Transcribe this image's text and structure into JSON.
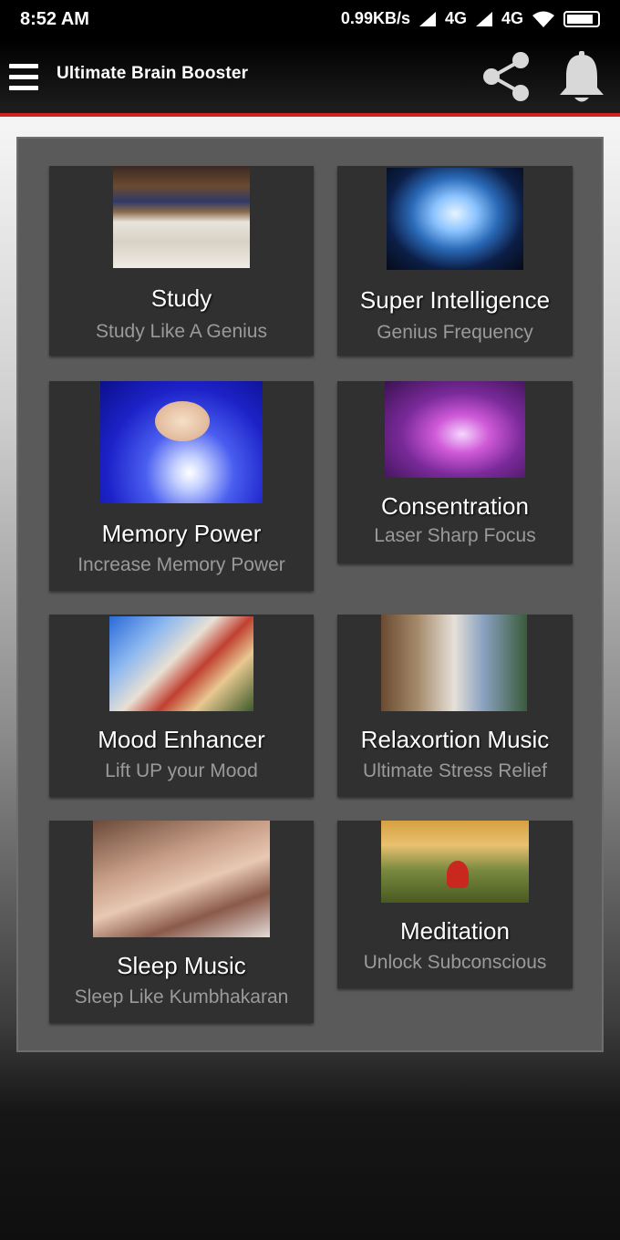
{
  "status_bar": {
    "time": "8:52 AM",
    "network": "0.99KB/s",
    "signal_a": "4G",
    "signal_b": "4G"
  },
  "app_bar": {
    "title": "Ultimate Brain Booster",
    "accent_color": "#d32222",
    "icons": [
      "menu-icon",
      "share-icon",
      "bell-icon"
    ]
  },
  "cards": [
    {
      "title": "Study",
      "subtitle": "Study Like A Genius",
      "image": "books-image"
    },
    {
      "title": "Super Intelligence",
      "subtitle": "Genius Frequency",
      "image": "glowing-brain-image"
    },
    {
      "title": "Memory Power",
      "subtitle": "Increase Memory Power",
      "image": "brain-bulb-image"
    },
    {
      "title": "Consentration",
      "subtitle": "Laser Sharp Focus",
      "image": "aura-image"
    },
    {
      "title": "Mood Enhancer",
      "subtitle": "Lift UP your Mood",
      "image": "collage-image"
    },
    {
      "title": "Relaxortion Music",
      "subtitle": "Ultimate Stress Relief",
      "image": "waterfall-image"
    },
    {
      "title": "Sleep Music",
      "subtitle": "Sleep Like Kumbhakaran",
      "image": "sleeping-woman-image"
    },
    {
      "title": "Meditation",
      "subtitle": "Unlock Subconscious",
      "image": "meditation-image"
    }
  ]
}
